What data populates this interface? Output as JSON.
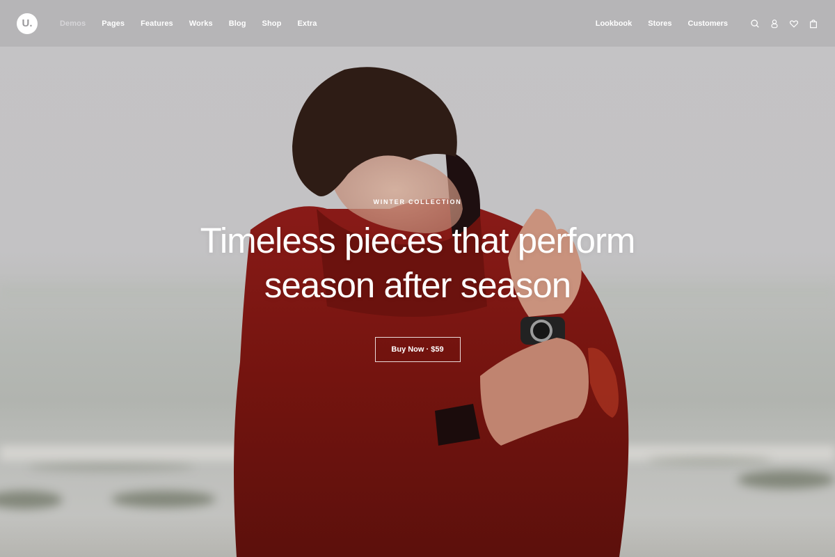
{
  "header": {
    "logo_text": "U.",
    "nav_left": [
      {
        "label": "Demos",
        "active": false,
        "muted": true
      },
      {
        "label": "Pages"
      },
      {
        "label": "Features"
      },
      {
        "label": "Works"
      },
      {
        "label": "Blog"
      },
      {
        "label": "Shop"
      },
      {
        "label": "Extra"
      }
    ],
    "nav_right": [
      {
        "label": "Lookbook"
      },
      {
        "label": "Stores"
      },
      {
        "label": "Customers"
      }
    ],
    "icons": [
      "search-icon",
      "account-icon",
      "wishlist-heart-icon",
      "shopping-bag-icon"
    ]
  },
  "hero": {
    "eyebrow": "WINTER COLLECTION",
    "headline_line1": "Timeless pieces that perform",
    "headline_line2": "season after season",
    "cta_label": "Buy Now · $59",
    "image_description": "Man in red rain jacket adjusting wristwatch by a misty sea"
  },
  "colors": {
    "header_bg": "#b8b7b9",
    "sky": "#c2c1c3",
    "jacket_red": "#7a1515",
    "text": "#ffffff"
  }
}
